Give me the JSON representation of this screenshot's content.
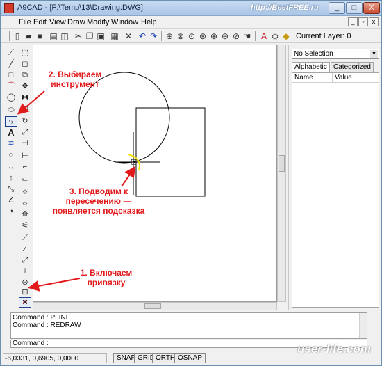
{
  "window": {
    "title": "A9CAD - [F:\\Temp\\13\\Drawing.DWG]",
    "watermark": "http://BestFREE.ru",
    "minimize": "_",
    "maximize": "□",
    "close": "X",
    "mdi_min": "_",
    "mdi_max": "▫",
    "mdi_close": "x"
  },
  "menu": [
    "File",
    "Edit",
    "View",
    "Draw",
    "Modify",
    "Window",
    "Help"
  ],
  "toolbar": {
    "current_layer_label": "Current Layer: 0"
  },
  "properties": {
    "selection": "No Selection",
    "tabs": [
      "Alphabetic",
      "Categorized"
    ],
    "columns": [
      "Name",
      "Value"
    ]
  },
  "command": {
    "history": [
      "Command : PLINE",
      "Command : REDRAW"
    ],
    "prompt": "Command :"
  },
  "status": {
    "coordinates": "-6,0331, 0,6905, 0,0000",
    "buttons": [
      "SNAP",
      "GRID",
      "ORTHO",
      "OSNAP"
    ]
  },
  "annotations": {
    "step1": "1. Включаем привязку",
    "step2": "2. Выбираем инструмент",
    "step3": "3. Подводим к пересечению — появляется подсказка"
  },
  "bottom_watermark": "user-life.com",
  "colors": {
    "annotation": "#e31a1c",
    "snap_marker": "#f2e300"
  }
}
